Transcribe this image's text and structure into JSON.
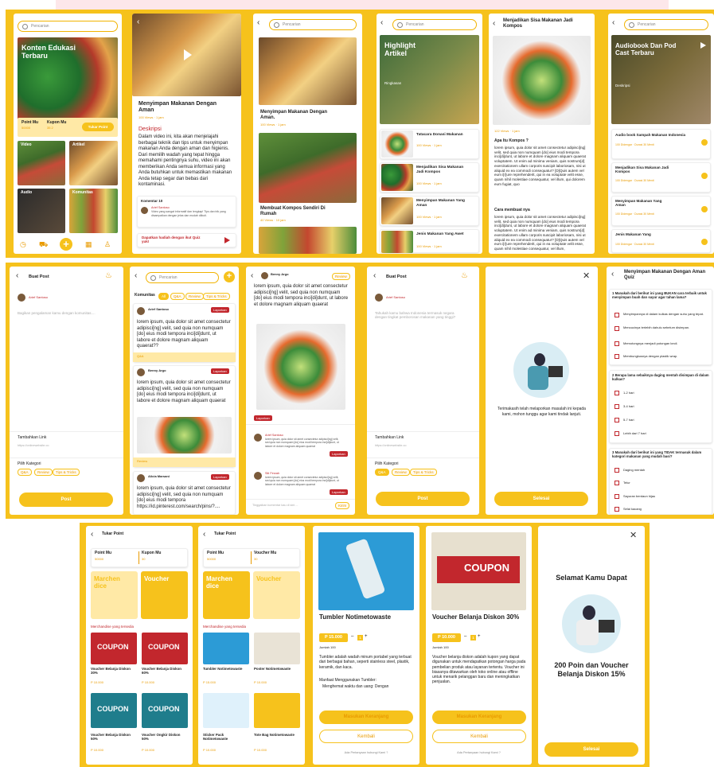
{
  "search": {
    "placeholder": "Pencarian"
  },
  "s1": {
    "hero_title": "Konten Edukasi Terbaru",
    "point_label": "Point Mu",
    "point_val": "50000",
    "kupon_label": "Kupon Mu",
    "kupon_val": "35 2",
    "tukar": "Tukar Point",
    "cat_video": "Video",
    "cat_artikel": "Artikel",
    "cat_audio": "Audio",
    "cat_komunitas": "Komunitas"
  },
  "s2": {
    "title": "Menyimpan Makanan Dengan Aman",
    "meta": "100 Views · 1 jam",
    "desc_h": "Deskripsi",
    "desc": "Dalam video ini, kita akan menjelajahi berbagai teknik dan tips untuk menyimpan makanan Anda dengan aman dan higienis. Dari memilih wadah yang tepat hingga memahami pentingnya suhu, video ini akan memberikan Anda semua informasi yang Anda butuhkan untuk memastikan makanan Anda tetap segar dan bebas dari kontaminasi.",
    "kom_h": "Komentar 10",
    "kom_user": "Arief Santoso",
    "kom_text": "Video yang sangat informatif dan lengkap! Tips dan trik yang disampaikan dengan jelas dan mudah diikuti.",
    "quiz": "Dapatkan hadiah dengan ikut Quiz yuk!"
  },
  "s3": {
    "t1": "Menyimpan Makanan Dengan Aman.",
    "m1": "100 Views · 1 jam",
    "t2": "Membuat Kompos Sendiri Di Rumah",
    "m2": "40 Views · 10 jam"
  },
  "s4": {
    "hero_title": "Highlight Artikel",
    "ringkasan": "Ringkasan",
    "items": [
      {
        "t": "Tatacara Donasi Makanan",
        "m": "100 Views · 1 jam"
      },
      {
        "t": "Menjadikan Sisa Makanan Jadi Kompos",
        "m": "100 Views · 1 jam"
      },
      {
        "t": "Menyimpan Makanan Yang Aman",
        "m": "100 Views · 1 jam"
      },
      {
        "t": "Jenis Makanan Yang Awet",
        "m": "100 Views · 1 jam"
      }
    ]
  },
  "s5": {
    "title": "Menjadikan Sisa Makanan Jadi Kompos",
    "meta": "122 Views · 1 jam",
    "h1": "Apa Itu Kompos ?",
    "p1": "lorem ipsum, quia dolor sit amet consectetur adipisci[ng] velit, sed quia non numquam [do] eius modi tempora inci[di]dunt, ut labore et dolore magnam aliquam quaerat voluptatem. Ut enim ad minima veniam, quis nostrum[d] exercitationem ullam corporis suscipit laboriosam, nisi ut aliquid ex ea commodi consequatur? [D]Quis autem vel eum i[r]ure reprehenderit, qui in ea voluptate velit esse, quam nihil molestiae consequatur, vel illum, qui dolorem eum fugiat, quo",
    "h2": "Cara membuat nya",
    "p2": "lorem ipsum, quia dolor sit amet consectetur adipisci[ng] velit, sed quia non numquam [do] eius modi tempora inci[di]dunt, ut labore et dolore magnam aliquam quaerat voluptatem. Ut enim ad minima veniam, quis nostrum[d] exercitationem ullam corporis suscipit laboriosam, nisi ut aliquid ex ea commodi consequatur? [D]Quis autem vel eum i[r]ure reprehenderit, qui in ea voluptate velit esse, quam nihil molestiae consequatur, vel illum,"
  },
  "s6": {
    "hero_title": "Audiobook Dan Pod Cast Terbaru",
    "deskripsi": "Deskripsi",
    "items": [
      {
        "t": "Audio book Sampah Makanan Indonesia",
        "m": "100 Didengar · Durasi 30 Menit"
      },
      {
        "t": "Menjadikan Sisa Makanan Jadi Kompos",
        "m": "100 Didengar · Durasi 30 Menit"
      },
      {
        "t": "Menyimpan Makanan Yang Aman",
        "m": "100 Didengar · Durasi 30 Menit"
      },
      {
        "t": "Jenis Makanan Yang",
        "m": "100 Didengar · Durasi 30 Menit"
      }
    ]
  },
  "s7": {
    "title": "Buat Post",
    "user": "Arief Santoso",
    "placeholder": "Bagikan pengalaman kamu dengan komunitas....",
    "link_h": "Tambahkan Link",
    "link_ph": "https://onlinewebsite.co",
    "kat_h": "Pilih Kategori",
    "k1": "Q&A",
    "k2": "Review",
    "k3": "Tips & Tricks",
    "post": "Post"
  },
  "s8": {
    "tab": "Komunitas",
    "f1": "All",
    "f2": "Q&A",
    "f3": "Review",
    "f4": "Tips & Tricks",
    "p1_user": "Arief Santoso",
    "p1_text": "lorem ipsum, quia dolor sit amet consectetur adipisci[ng] velit, sed quia non numquam [do] eius modi tempora inci[di]dunt, ut labore et dolore magnam aliquam quaerat??",
    "p2_user": "Benny Argo",
    "p2_text": "lorem ipsum, quia dolor sit amet consectetur adipisci[ng] velit, sed quia non numquam [do] eius modi tempora inci[di]dunt, ut labore et dolore magnam aliquam quaerat",
    "p3_user": "Alicia Marsani",
    "p3_text": "lorem ipsum, quia dolor sit amet consectetur adipisci[ng] velit, sed quia non numquam [do] eius modi tempora https://id.pinterest.com/search/pins/?....",
    "lapor": "Laporkan",
    "tag_qa": "Q&A",
    "tag_review": "Review"
  },
  "s9": {
    "user": "Benny Argo",
    "tag": "Review",
    "text": "lorem ipsum, quia dolor sit amet consectetur adipisci[ng] velit, sed quia non numquam [do] eius modi tempora inci[di]dunt, ut labore et dolore magnam aliquam quaerat",
    "c1_user": "Arief Santoso",
    "c2_user": "Siti Ferzah",
    "reply_ph": "Tinggalkan komentar kau di sini ...",
    "send": "Kirim"
  },
  "s10": {
    "title": "Buat Post",
    "user": "Arief Santoso",
    "text": "Tahukah kamu bahwa Indonesia termasuk negara dengan tingkat pemborosan makanan yang tinggi?",
    "link_h": "Tambahkan Link",
    "link_ph": "https://onlinewebsite.co",
    "kat_h": "Pilih Kategori",
    "k1": "Q&A",
    "k2": "Review",
    "k3": "Tips & Tricks",
    "post": "Post"
  },
  "s11": {
    "msg": "Terimakasih telah melaporkan masalah ini kepada kami, mohon tunggu agar kami tindak lanjuti.",
    "btn": "Selesai"
  },
  "s12": {
    "title": "Menyimpan Makanan Dengan Aman Quiz",
    "q1": "1  Manakah dari berikut ini yang BUKAN cara terbaik untuk menyimpan buah dan sayur agar tahan lama?",
    "q1o": [
      "Menyimpannya di dalam kulkas dengan suhu yang tepat.",
      "Mencucinya terlebih dahulu sebelum disimpan.",
      "Memotongnya menjadi potongan kecil.",
      "Membungkusnya dengan plastik wrap."
    ],
    "q2": "2  Berapa lama sebaiknya daging mentah disimpan di dalam kulkas?",
    "q2o": [
      "1-2 hari",
      "3-4 hari",
      "5-7 hari",
      "Lebih dari 7 hari"
    ],
    "q3": "3  Manakah dari berikut ini yang TIDAK termasuk dalam kategori makanan yang mudah basi?",
    "q3o": [
      "Daging mentah",
      "Telur",
      "Sayuran berdaun hijau",
      "Selai kacang"
    ]
  },
  "s13": {
    "title": "Tukar Point",
    "point_label": "Point Mu",
    "point_val": "50000",
    "kupon_label": "Kupon Mu",
    "kupon_val": "30",
    "merch": "Marchen dice",
    "voucher": "Voucher",
    "list_h": "Merchandise yang tersedia",
    "items": [
      {
        "t": "Voucher Belanja Diskon 30%",
        "p": "P 10.000"
      },
      {
        "t": "Voucher Belanja Diskon 60%",
        "p": "P 10.000"
      },
      {
        "t": "Voucher Belanja Diskon 50%",
        "p": "P 10.000"
      },
      {
        "t": "Voucher Ongkir Diskon 50%",
        "p": "P 10.000"
      }
    ],
    "coupon": "COUPON"
  },
  "s14": {
    "title": "Tukar Point",
    "point_label": "Point Mu",
    "point_val": "50000",
    "kupon_label": "Voucher Mu",
    "kupon_val": "30",
    "merch": "Marchen dice",
    "voucher": "Voucher",
    "list_h": "Merchandise yang tersedia",
    "items": [
      {
        "t": "Tumbler Notimetowaste",
        "p": "P 15.000"
      },
      {
        "t": "Poster Notimetowaste",
        "p": "P 10.000"
      },
      {
        "t": "Sticker Pack Notimetowaste",
        "p": "P 10.000"
      },
      {
        "t": "Tote Bag Notimetowaste",
        "p": "P 10.000"
      }
    ]
  },
  "s15": {
    "title": "Tumbler Notimetowaste",
    "price": "P 15.000",
    "qty": "1",
    "stock": "Jumlah 100",
    "desc": "Tumbler adalah wadah minum portabel yang terbuat dari berbagai bahan, seperti stainless steel, plastik, keramik, dan kaca.",
    "manfaat": "Manfaat Menggunakan Tumbler:",
    "bullet": "Menghemat waktu dan uang: Dengan",
    "btn1": "Masukan Keranjang",
    "btn2": "Kembali",
    "help": "Ada Pertanyaan hubungi Kami ?"
  },
  "s16": {
    "title": "Voucher Belanja Diskon 30%",
    "coupon": "COUPON",
    "price": "P 10.000",
    "qty": "1",
    "stock": "Jumlah 100",
    "desc": "Voucher belanja diskon adalah kupon yang dapat digunakan untuk mendapatkan potongan harga pada pembelian produk atau layanan tertentu. Voucher ini biasanya ditawarkan oleh toko online atau offline untuk menarik pelanggan baru dan meningkatkan penjualan.",
    "btn1": "Masukan Keranjang",
    "btn2": "Kembali",
    "help": "Ada Pertanyaan hubungi Kami ?"
  },
  "s17": {
    "title": "Selamat Kamu Dapat",
    "reward": "200 Poin dan Voucher Belanja Diskon 15%",
    "btn": "Selesai"
  }
}
